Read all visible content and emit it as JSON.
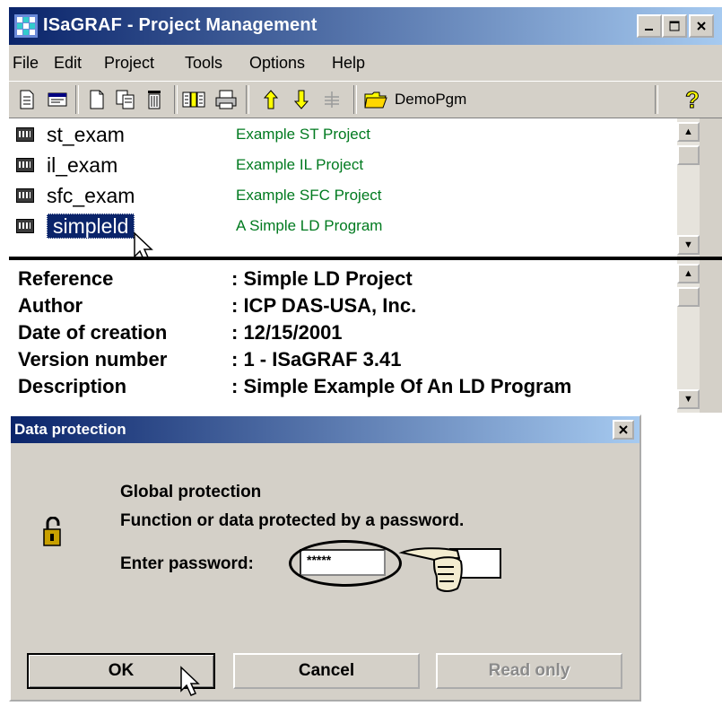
{
  "window": {
    "title": "ISaGRAF - Project Management",
    "controls": [
      "_",
      "□",
      "×"
    ]
  },
  "menu": [
    "File",
    "Edit",
    "Project",
    "Tools",
    "Options",
    "Help"
  ],
  "toolbar": {
    "demo_label": "DemoPgm",
    "icons": [
      "edit-icon",
      "properties-icon",
      "new-icon",
      "copy-icon",
      "delete-icon",
      "libraries-icon",
      "print-icon",
      "move-up-icon",
      "move-down-icon",
      "disabled-icon",
      "folder-icon",
      "help-icon"
    ]
  },
  "projects": [
    {
      "name": "st_exam",
      "desc": "Example ST Project"
    },
    {
      "name": "il_exam",
      "desc": "Example IL Project"
    },
    {
      "name": "sfc_exam",
      "desc": "Example SFC Project"
    },
    {
      "name": "simpleld",
      "desc": "A Simple LD Program",
      "selected": true
    }
  ],
  "details": [
    {
      "label": "Reference",
      "value": ": Simple LD Project"
    },
    {
      "label": "Author",
      "value": ": ICP DAS-USA, Inc."
    },
    {
      "label": "Date of creation",
      "value": ": 12/15/2001"
    },
    {
      "label": "Version number",
      "value": ": 1 - ISaGRAF 3.41"
    },
    {
      "label": "Description",
      "value": ": Simple Example Of An LD Program"
    }
  ],
  "dialog": {
    "title": "Data protection",
    "line1": "Global protection",
    "line2": "Function or data protected by a password.",
    "prompt": "Enter password:",
    "password": "*****",
    "ok": "OK",
    "cancel": "Cancel",
    "readonly": "Read only"
  },
  "colors": {
    "titlebar_start": "#0a246a",
    "titlebar_end": "#a6caf0",
    "face": "#d4d0c8",
    "desc_green": "#007a1f"
  }
}
